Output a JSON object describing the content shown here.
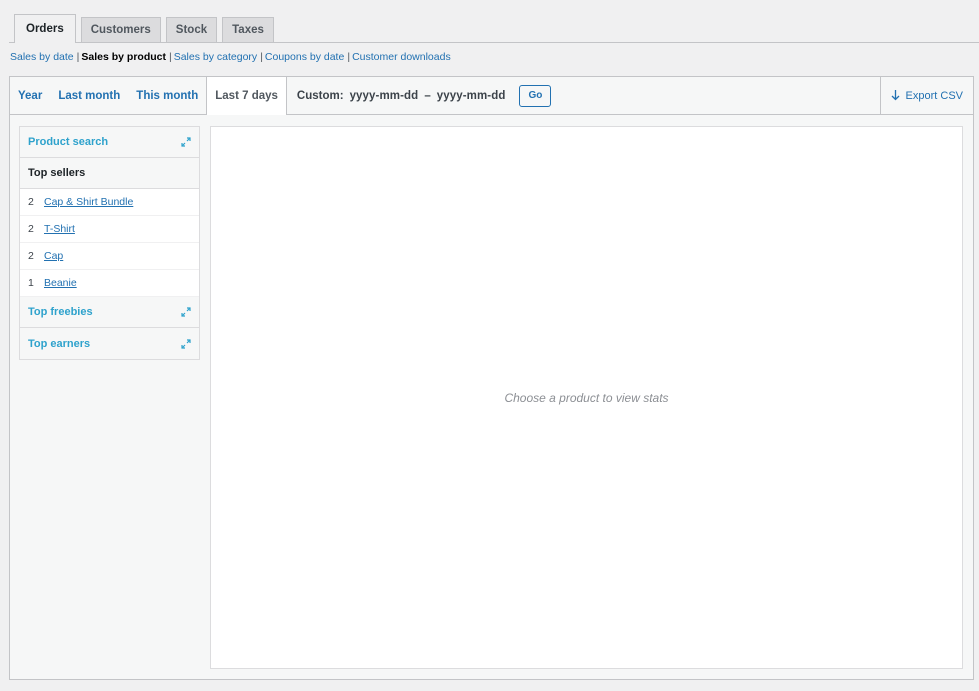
{
  "tabs": [
    {
      "label": "Orders"
    },
    {
      "label": "Customers"
    },
    {
      "label": "Stock"
    },
    {
      "label": "Taxes"
    }
  ],
  "subnav": [
    {
      "label": "Sales by date"
    },
    {
      "label": "Sales by product"
    },
    {
      "label": "Sales by category"
    },
    {
      "label": "Coupons by date"
    },
    {
      "label": "Customer downloads"
    }
  ],
  "ranges": [
    {
      "label": "Year"
    },
    {
      "label": "Last month"
    },
    {
      "label": "This month"
    },
    {
      "label": "Last 7 days"
    }
  ],
  "custom": {
    "label": "Custom:",
    "start_placeholder": "yyyy-mm-dd",
    "dash": "–",
    "end_placeholder": "yyyy-mm-dd",
    "go_label": "Go"
  },
  "export": {
    "icon": "download-arrow-icon",
    "label": "Export CSV"
  },
  "sidebar": {
    "product_search": "Product search",
    "top_sellers": "Top sellers",
    "sellers": [
      {
        "count": "2",
        "name": "Cap & Shirt Bundle"
      },
      {
        "count": "2",
        "name": "T-Shirt"
      },
      {
        "count": "2",
        "name": "Cap"
      },
      {
        "count": "1",
        "name": "Beanie"
      }
    ],
    "top_freebies": "Top freebies",
    "top_earners": "Top earners"
  },
  "chart_message": "Choose a product to view stats",
  "colors": {
    "link": "#2271b1",
    "section_heading": "#2ea2cc"
  }
}
